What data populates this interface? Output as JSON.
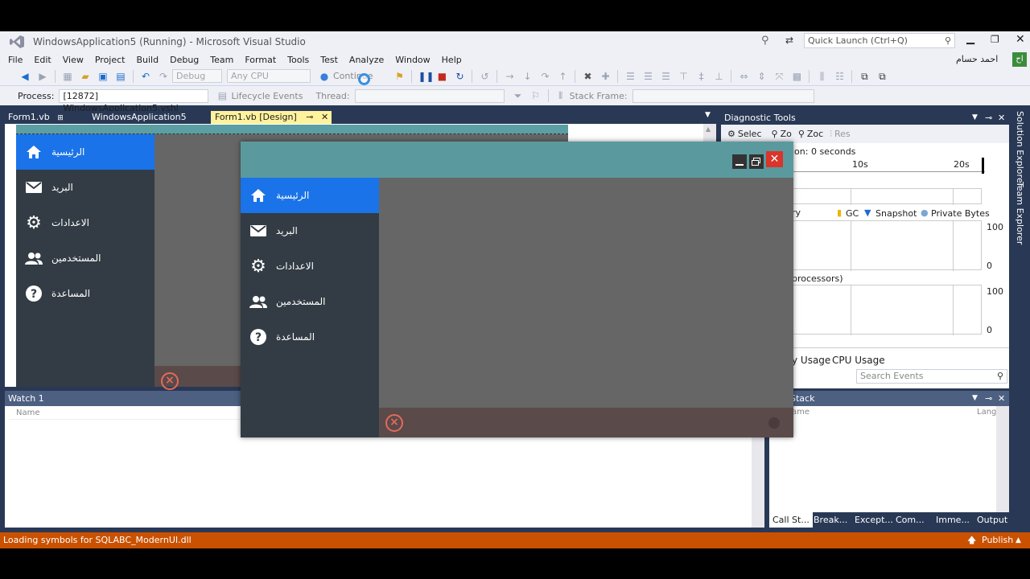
{
  "window": {
    "title": "WindowsApplication5 (Running) - Microsoft Visual Studio",
    "quick_launch_placeholder": "Quick Launch (Ctrl+Q)",
    "user_name": "احمد حسام",
    "user_initials": "اح"
  },
  "menu": [
    "File",
    "Edit",
    "View",
    "Project",
    "Build",
    "Debug",
    "Team",
    "Format",
    "Tools",
    "Test",
    "Analyze",
    "Window",
    "Help"
  ],
  "toolbar": {
    "config": "Debug",
    "platform": "Any CPU",
    "continue_label": "Continue",
    "process_label": "Process:",
    "process_value": "[12872] WindowsApplication5.vshi",
    "lifecycle_label": "Lifecycle Events",
    "thread_label": "Thread:",
    "stack_frame_label": "Stack Frame:"
  },
  "doc_tabs": [
    {
      "label": "Form1.vb",
      "pin": "⊞"
    },
    {
      "label": "WindowsApplication5"
    },
    {
      "label": "Form1.vb [Design]"
    }
  ],
  "nav_items": [
    {
      "label": "الرئيسية",
      "icon": "home-icon"
    },
    {
      "label": "البريد",
      "icon": "mail-icon"
    },
    {
      "label": "الاعدادات",
      "icon": "gear-icon"
    },
    {
      "label": "المستخدمين",
      "icon": "users-icon"
    },
    {
      "label": "المساعدة",
      "icon": "help-icon"
    }
  ],
  "watch": {
    "title": "Watch 1",
    "col_name": "Name"
  },
  "diagnostics": {
    "title": "Diagnostic Tools",
    "tools": [
      "Selec",
      "Zo",
      "Zoc",
      "Res"
    ],
    "session_text": "ion: 0 seconds",
    "ticks": [
      "10s",
      "20s"
    ],
    "memory_label": "ry",
    "legend": [
      "GC",
      "Snapshot",
      "Private Bytes"
    ],
    "axis_max": "100",
    "axis_min": "0",
    "cpu_label": "processors)",
    "tabs": [
      "y Usage",
      "CPU Usage"
    ],
    "search_placeholder": "Search Events"
  },
  "callstack": {
    "title": "Stack",
    "col_name": "ame",
    "col_lang": "Lang",
    "tabs": [
      "Call St...",
      "Break...",
      "Except...",
      "Com...",
      "Imme...",
      "Output"
    ]
  },
  "right_strip": [
    "Solution Explorer",
    "Team Explorer"
  ],
  "status": {
    "message": "Loading symbols for SQLABC_ModernUI.dll",
    "publish": "Publish"
  },
  "colors": {
    "vs_frame": "#293955",
    "status_bar": "#ca5100",
    "form_header": "#5a9a9f",
    "sidebar": "#333c44",
    "nav_selected": "#1a73e8",
    "close_button": "#d9352a"
  }
}
